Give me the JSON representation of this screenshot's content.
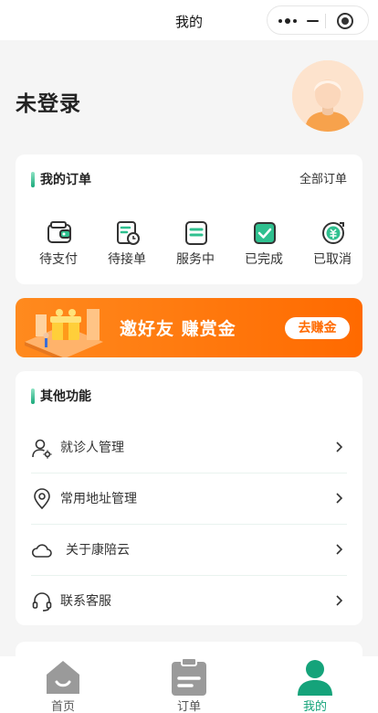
{
  "nav": {
    "title": "我的"
  },
  "profile": {
    "login_text": "未登录"
  },
  "orders": {
    "title": "我的订单",
    "all_link": "全部订单",
    "items": [
      {
        "label": "待支付",
        "icon": "wallet-icon"
      },
      {
        "label": "待接单",
        "icon": "pending-order-icon"
      },
      {
        "label": "服务中",
        "icon": "in-service-icon"
      },
      {
        "label": "已完成",
        "icon": "completed-check-icon"
      },
      {
        "label": "已取消",
        "icon": "cancelled-refund-icon"
      }
    ]
  },
  "banner": {
    "text": "邀好友 赚赏金",
    "button": "去赚金"
  },
  "functions": {
    "title": "其他功能",
    "items": [
      {
        "label": "就诊人管理",
        "icon": "patient-settings-icon"
      },
      {
        "label": "常用地址管理",
        "icon": "location-pin-icon"
      },
      {
        "label": "关于康陪云",
        "icon": "cloud-icon"
      },
      {
        "label": "联系客服",
        "icon": "headset-icon"
      }
    ]
  },
  "tabbar": {
    "items": [
      {
        "label": "首页",
        "icon": "home-icon",
        "active": false
      },
      {
        "label": "订单",
        "icon": "clipboard-icon",
        "active": false
      },
      {
        "label": "我的",
        "icon": "user-icon",
        "active": true
      }
    ]
  },
  "colors": {
    "accent": "#15a37a",
    "banner": "#ff6a00",
    "avatar_bg": "#fde3cd"
  }
}
